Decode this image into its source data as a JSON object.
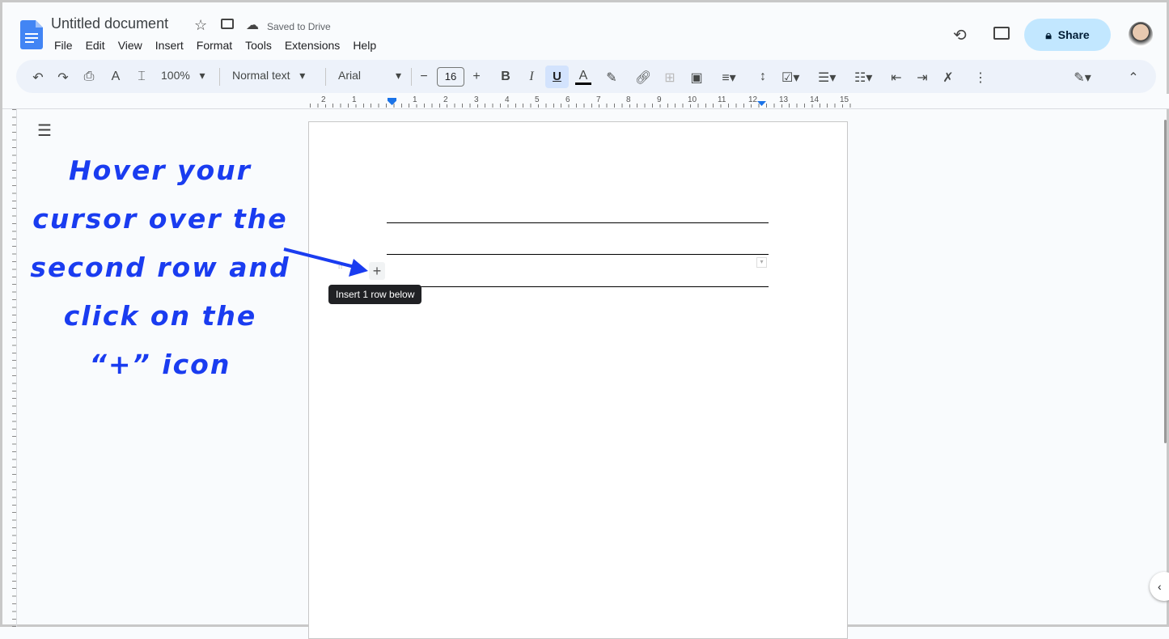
{
  "app": {
    "title": "Untitled document",
    "save_status": "Saved to Drive",
    "share_label": "Share"
  },
  "menu": [
    "File",
    "Edit",
    "View",
    "Insert",
    "Format",
    "Tools",
    "Extensions",
    "Help"
  ],
  "toolbar": {
    "zoom": "100%",
    "style": "Normal text",
    "font": "Arial",
    "font_size": "16"
  },
  "ruler_labels": [
    "2",
    "1",
    "1",
    "2",
    "3",
    "4",
    "5",
    "6",
    "7",
    "8",
    "9",
    "10",
    "11",
    "12",
    "13",
    "14",
    "15"
  ],
  "tooltip": "Insert 1 row below",
  "annotation": [
    "Hover your",
    "cursor over the",
    "second row and",
    "click on the",
    "“+” icon"
  ],
  "colors": {
    "accent": "#1a73e8",
    "annotation": "#1a3cf0",
    "share_bg": "#c2e7ff"
  }
}
